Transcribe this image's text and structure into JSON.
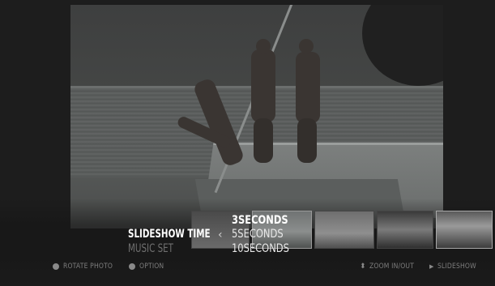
{
  "menu": {
    "slideshow_time_label": "SLIDESHOW TIME",
    "music_set_label": "MUSIC SET",
    "chevron": "‹",
    "options": [
      "3SECONDS",
      "5SECONDS",
      "10SECONDS"
    ],
    "selected_option": "3SECONDS"
  },
  "hints": {
    "rotate_photo": "ROTATE PHOTO",
    "option": "OPTION",
    "zoom": "ZOOM IN/OUT",
    "slideshow": "SLIDESHOW"
  },
  "icons": {
    "rotate": "dot-icon",
    "option": "dot-icon",
    "zoom": "updown-arrow-icon",
    "slideshow": "play-icon"
  },
  "colors": {
    "background": "#1d1d1d",
    "active_text": "#ffffff",
    "dim_text": "#6f6f6f",
    "hint_text": "#7d7d7d"
  }
}
